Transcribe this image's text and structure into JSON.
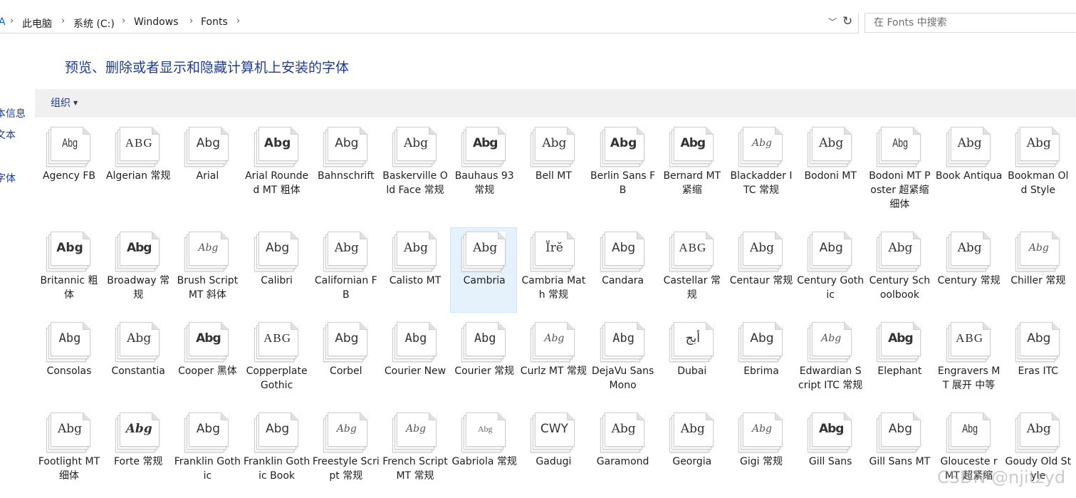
{
  "address": {
    "back_glyph": "A",
    "crumbs": [
      "此电脑",
      "系统 (C:)",
      "Windows",
      "Fonts"
    ]
  },
  "search": {
    "placeholder": "在 Fonts 中搜索"
  },
  "heading": "预览、删除或者显示和隐藏计算机上安装的字体",
  "left_nav": [
    "本信息",
    "文本",
    "字体"
  ],
  "toolbar": {
    "organize_label": "组织"
  },
  "fonts": [
    {
      "name": "Agency FB",
      "sample": "Abg",
      "style": "condensed"
    },
    {
      "name": "Algerian 常规",
      "sample": "ABG",
      "style": "caps"
    },
    {
      "name": "Arial",
      "sample": "Abg",
      "style": "sans"
    },
    {
      "name": "Arial Rounded MT 粗体",
      "sample": "Abg",
      "style": "bold"
    },
    {
      "name": "Bahnschrift",
      "sample": "Abg",
      "style": "sans"
    },
    {
      "name": "Baskerville Old Face 常规",
      "sample": "Abg",
      "style": "serif"
    },
    {
      "name": "Bauhaus 93 常规",
      "sample": "Abg",
      "style": "heavy"
    },
    {
      "name": "Bell MT",
      "sample": "Abg",
      "style": "serif"
    },
    {
      "name": "Berlin Sans FB",
      "sample": "Abg",
      "style": "bold"
    },
    {
      "name": "Bernard MT 紧缩",
      "sample": "Abg",
      "style": "heavy"
    },
    {
      "name": "Blackadder ITC 常规",
      "sample": "Abg",
      "style": "script"
    },
    {
      "name": "Bodoni MT",
      "sample": "Abg",
      "style": "serif"
    },
    {
      "name": "Bodoni MT Poster 超紧缩 细体",
      "sample": "Abg",
      "style": "condensed"
    },
    {
      "name": "Book Antiqua",
      "sample": "Abg",
      "style": "serif"
    },
    {
      "name": "Bookman Old Style",
      "sample": "Abg",
      "style": "serif"
    },
    {
      "name": "Britannic 粗体",
      "sample": "Abg",
      "style": "bold"
    },
    {
      "name": "Broadway 常规",
      "sample": "Abg",
      "style": "heavy"
    },
    {
      "name": "Brush Script MT 斜体",
      "sample": "Abg",
      "style": "script"
    },
    {
      "name": "Calibri",
      "sample": "Abg",
      "style": "sans"
    },
    {
      "name": "Californian FB",
      "sample": "Abg",
      "style": "serif"
    },
    {
      "name": "Calisto MT",
      "sample": "Abg",
      "style": "serif"
    },
    {
      "name": "Cambria",
      "sample": "Abg",
      "style": "serif",
      "selected": true
    },
    {
      "name": "Cambria Math 常规",
      "sample": "Ïrĕ",
      "style": "serif"
    },
    {
      "name": "Candara",
      "sample": "Abg",
      "style": "sans"
    },
    {
      "name": "Castellar 常规",
      "sample": "ABG",
      "style": "caps"
    },
    {
      "name": "Centaur 常规",
      "sample": "Abg",
      "style": "serif"
    },
    {
      "name": "Century Gothic",
      "sample": "Abg",
      "style": "sans"
    },
    {
      "name": "Century Schoolbook",
      "sample": "Abg",
      "style": "serif"
    },
    {
      "name": "Century 常规",
      "sample": "Abg",
      "style": "serif"
    },
    {
      "name": "Chiller 常规",
      "sample": "Abg",
      "style": "script"
    },
    {
      "name": "Consolas",
      "sample": "Abg",
      "style": "mono"
    },
    {
      "name": "Constantia",
      "sample": "Abg",
      "style": "serif"
    },
    {
      "name": "Cooper 黑体",
      "sample": "Abg",
      "style": "heavy"
    },
    {
      "name": "Copperplate Gothic",
      "sample": "ABG",
      "style": "caps"
    },
    {
      "name": "Corbel",
      "sample": "Abg",
      "style": "sans"
    },
    {
      "name": "Courier New",
      "sample": "Abg",
      "style": "mono"
    },
    {
      "name": "Courier 常规",
      "sample": "Abg",
      "style": "mono"
    },
    {
      "name": "Curlz MT 常规",
      "sample": "Abg",
      "style": "script"
    },
    {
      "name": "DejaVu Sans Mono",
      "sample": "Abg",
      "style": "mono"
    },
    {
      "name": "Dubai",
      "sample": "أبج",
      "style": "sans"
    },
    {
      "name": "Ebrima",
      "sample": "Abg",
      "style": "sans"
    },
    {
      "name": "Edwardian Script ITC 常规",
      "sample": "Abg",
      "style": "script"
    },
    {
      "name": "Elephant",
      "sample": "Abg",
      "style": "heavy"
    },
    {
      "name": "Engravers MT 展开 中等",
      "sample": "ABG",
      "style": "caps"
    },
    {
      "name": "Eras ITC",
      "sample": "Abg",
      "style": "sans"
    },
    {
      "name": "Footlight MT 细体",
      "sample": "Abg",
      "style": "serif"
    },
    {
      "name": "Forte 常规",
      "sample": "Abg",
      "style": "script-bold"
    },
    {
      "name": "Franklin Gothic",
      "sample": "Abg",
      "style": "sans"
    },
    {
      "name": "Franklin Gothic Book",
      "sample": "Abg",
      "style": "sans"
    },
    {
      "name": "Freestyle Script 常规",
      "sample": "Abg",
      "style": "script"
    },
    {
      "name": "French Script MT 常规",
      "sample": "Abg",
      "style": "script"
    },
    {
      "name": "Gabriola 常规",
      "sample": "Abg",
      "style": "small"
    },
    {
      "name": "Gadugi",
      "sample": "CWY",
      "style": "sans"
    },
    {
      "name": "Garamond",
      "sample": "Abg",
      "style": "serif"
    },
    {
      "name": "Georgia",
      "sample": "Abg",
      "style": "serif"
    },
    {
      "name": "Gigi 常规",
      "sample": "Abg",
      "style": "script"
    },
    {
      "name": "Gill Sans",
      "sample": "Abg",
      "style": "heavy"
    },
    {
      "name": "Gill Sans MT",
      "sample": "Abg",
      "style": "sans"
    },
    {
      "name": "Glouceste r MT 超紧缩",
      "sample": "Abg",
      "style": "condensed"
    },
    {
      "name": "Goudy Old Style",
      "sample": "Abg",
      "style": "serif"
    }
  ],
  "watermark": "CSDN @njitzyd"
}
